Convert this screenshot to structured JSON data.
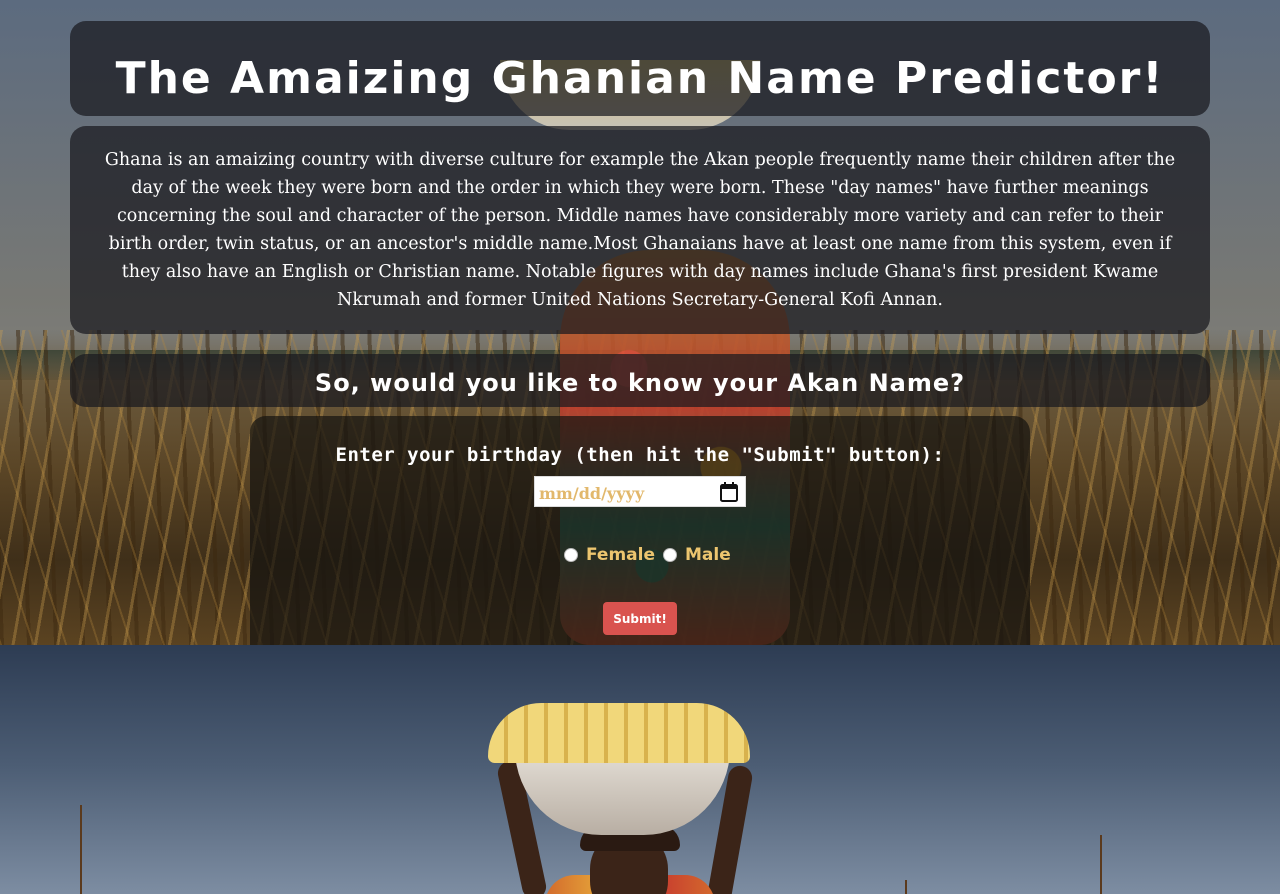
{
  "header": {
    "title": "The Amaizing Ghanian Name Predictor!"
  },
  "intro": {
    "text": "Ghana is an amaizing country with diverse culture for example the Akan people frequently name their children after the day of the week they were born and the order in which they were born. These \"day names\" have further meanings concerning the soul and character of the person. Middle names have considerably more variety and can refer to their birth order, twin status, or an ancestor's middle name.Most Ghanaians have at least one name from this system, even if they also have an English or Christian name. Notable figures with day names include Ghana's first president Kwame Nkrumah and former United Nations Secretary-General Kofi Annan."
  },
  "question": {
    "text": "So, would you like to know your Akan Name?"
  },
  "form": {
    "birthday_label": "Enter your birthday (then hit the \"Submit\" button):",
    "date_placeholder": "mm/dd/yyyy",
    "calendar_icon": "calendar-icon",
    "gender_options": [
      {
        "label": "Female",
        "selected": false
      },
      {
        "label": "Male",
        "selected": false
      }
    ],
    "submit_label": "Submit!"
  },
  "colors": {
    "accent_gold": "#ecc56f",
    "submit_red": "#d9534f",
    "panel_bg": "rgba(25,25,30,0.72)"
  }
}
